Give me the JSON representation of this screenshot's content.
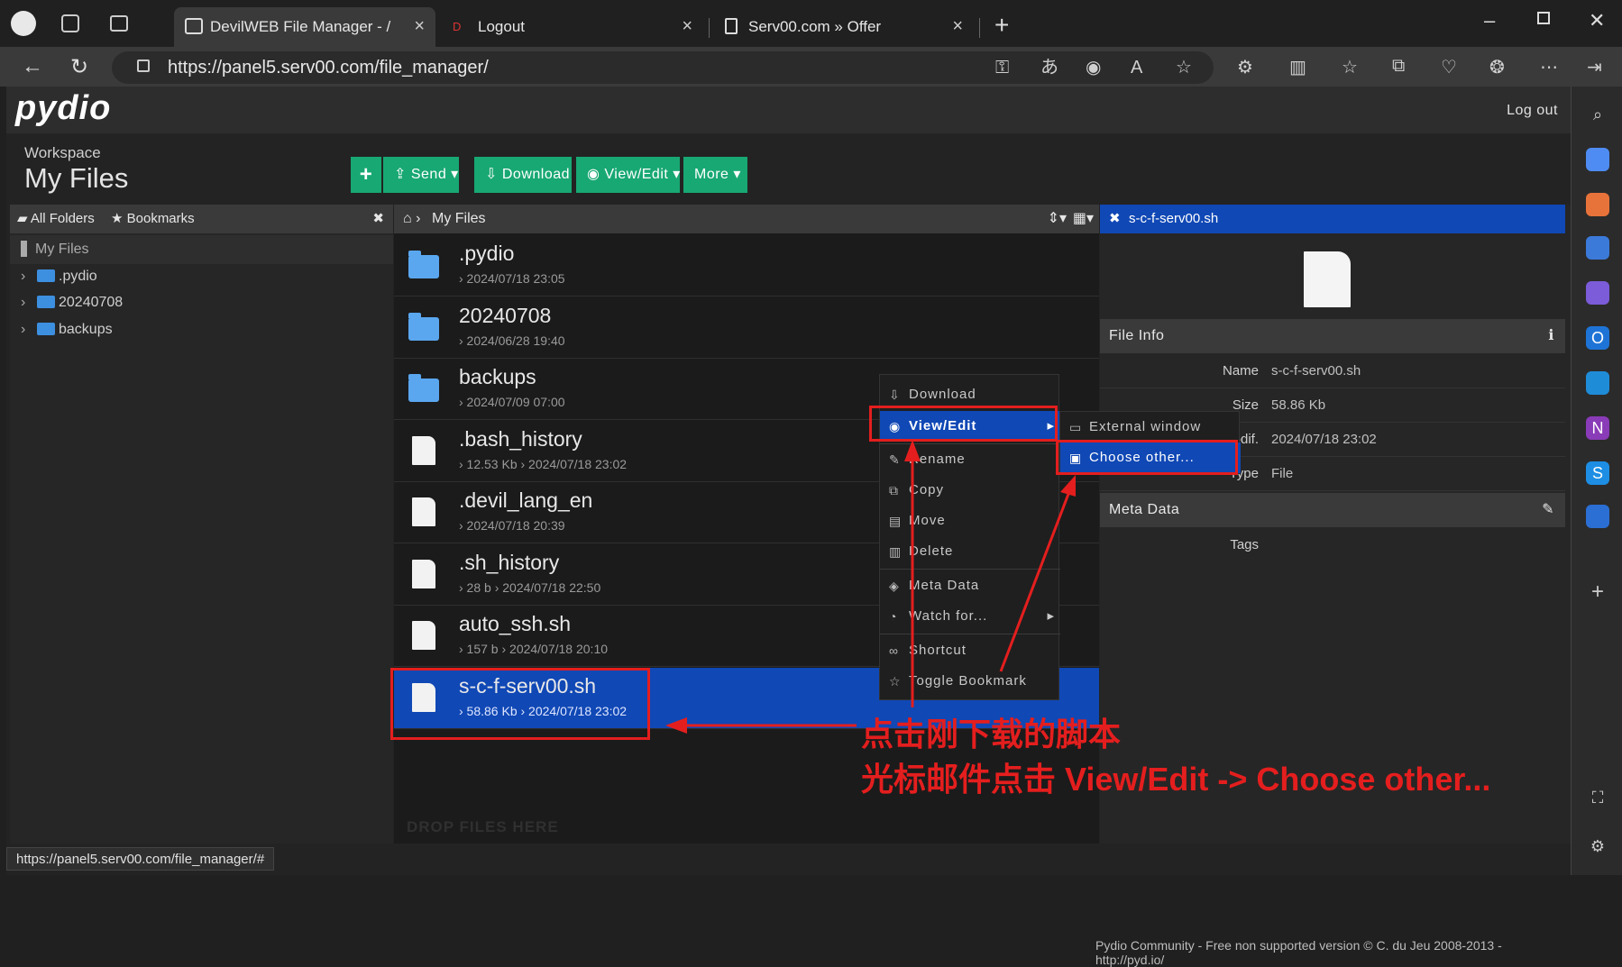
{
  "browser": {
    "tabs": [
      {
        "title": "DevilWEB File Manager - /",
        "active": true
      },
      {
        "title": "Logout",
        "active": false
      },
      {
        "title": "Serv00.com » Offer",
        "active": false
      }
    ],
    "url": "https://panel5.serv00.com/file_manager/",
    "status_url": "https://panel5.serv00.com/file_manager/#"
  },
  "app": {
    "logo": "pydio",
    "logout": "Log out",
    "workspace_label": "Workspace",
    "workspace_title": "My Files",
    "toolbar": {
      "add": "+",
      "send": "Send",
      "download": "Download",
      "view_edit": "View/Edit",
      "more": "More"
    }
  },
  "left_panel": {
    "tab_all": "All Folders",
    "tab_bookmarks": "Bookmarks",
    "root": "My Files",
    "folders": [
      ".pydio",
      "20240708",
      "backups"
    ]
  },
  "middle_panel": {
    "breadcrumb": "My Files",
    "files": [
      {
        "name": ".pydio",
        "meta": "› 2024/07/18 23:05",
        "type": "folder"
      },
      {
        "name": "20240708",
        "meta": "› 2024/06/28 19:40",
        "type": "folder"
      },
      {
        "name": "backups",
        "meta": "› 2024/07/09 07:00",
        "type": "folder"
      },
      {
        "name": ".bash_history",
        "meta": "› 12.53 Kb › 2024/07/18 23:02",
        "type": "file"
      },
      {
        "name": ".devil_lang_en",
        "meta": "› 2024/07/18 20:39",
        "type": "file"
      },
      {
        "name": ".sh_history",
        "meta": "› 28 b › 2024/07/18 22:50",
        "type": "file"
      },
      {
        "name": "auto_ssh.sh",
        "meta": "› 157 b › 2024/07/18 20:10",
        "type": "file"
      },
      {
        "name": "s-c-f-serv00.sh",
        "meta": "› 58.86 Kb › 2024/07/18 23:02",
        "type": "file",
        "selected": true
      }
    ],
    "drop_hint": "DROP FILES HERE"
  },
  "right_panel": {
    "title": "s-c-f-serv00.sh",
    "file_info_label": "File Info",
    "info": [
      {
        "k": "Name",
        "v": "s-c-f-serv00.sh"
      },
      {
        "k": "Size",
        "v": "58.86 Kb"
      },
      {
        "k": "Modif.",
        "v": "2024/07/18 23:02"
      },
      {
        "k": "Type",
        "v": "File"
      }
    ],
    "meta_label": "Meta Data",
    "tags_label": "Tags"
  },
  "context_menu": {
    "items": [
      "Download",
      "View/Edit",
      "Rename",
      "Copy",
      "Move",
      "Delete",
      "Meta Data",
      "Watch for...",
      "Shortcut",
      "Toggle Bookmark"
    ],
    "submenu": [
      "External window",
      "Choose other..."
    ]
  },
  "annotation": {
    "line1": "点击刚下载的脚本",
    "line2": "光标邮件点击 View/Edit -> Choose other..."
  },
  "footer": "Pydio Community - Free non supported version © C. du Jeu 2008-2013 - http://pyd.io/",
  "colors": {
    "accent_green": "#18a873",
    "selection_blue": "#1048b5",
    "annotation_red": "#e41e1e"
  }
}
